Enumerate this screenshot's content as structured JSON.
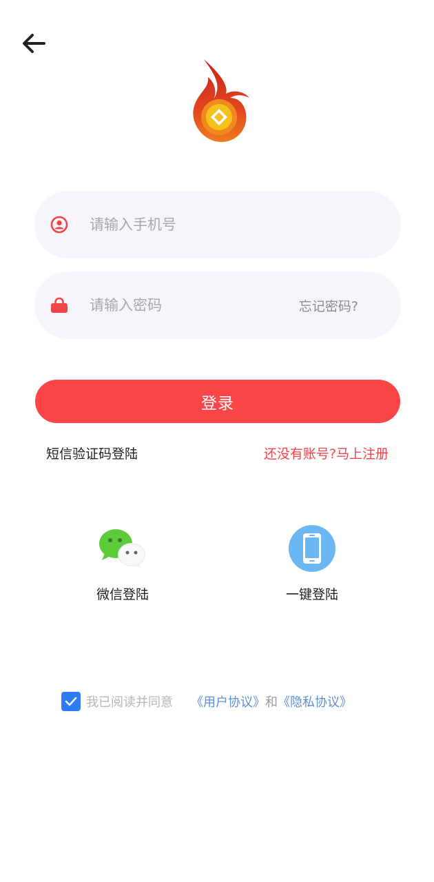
{
  "login": {
    "phone": {
      "placeholder": "请输入手机号",
      "value": ""
    },
    "password": {
      "placeholder": "请输入密码",
      "value": "",
      "forgot_label": "忘记密码?"
    },
    "submit_label": "登录",
    "sms_login_label": "短信验证码登陆",
    "register_label": "还没有账号?马上注册"
  },
  "social": {
    "wechat_label": "微信登陆",
    "onekey_label": "一键登陆"
  },
  "agreement": {
    "checked": true,
    "prefix": "我已阅读并同意",
    "user_agreement": "《用户协议》",
    "and": "和",
    "privacy_agreement": "《隐私协议》"
  },
  "icons": {
    "back": "arrow-left-icon",
    "logo": "flame-coin-logo",
    "phone_field": "user-circle-icon",
    "password_field": "lock-icon",
    "wechat": "wechat-icon",
    "onekey": "smartphone-icon",
    "checkbox": "check-icon"
  },
  "colors": {
    "accent_red": "#fa4549",
    "register_red": "#f04448",
    "field_bg": "#f7f5fb",
    "link_blue": "#5e8fd1",
    "checkbox_blue": "#2d7cf4",
    "wechat_green": "#5ecb3b",
    "onekey_blue": "#6ab7f2"
  }
}
